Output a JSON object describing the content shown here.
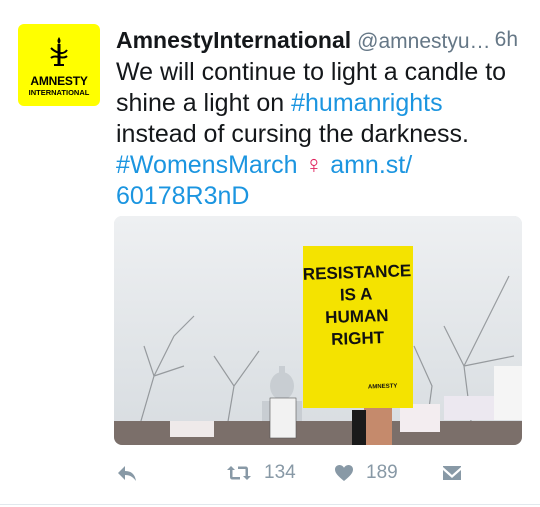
{
  "avatar": {
    "brand_line1": "AMNESTY",
    "brand_line2": "INTERNATIONAL",
    "icon": "candle-logo-icon",
    "color": "#ffff00"
  },
  "tweet": {
    "display_name": "AmnestyInternational",
    "handle": "@amnestyu…",
    "time": "6h",
    "text_part1": "We will continue to light a candle to shine a light on ",
    "hashtag1": "#humanrights",
    "text_part2": " instead of cursing the darkness. ",
    "hashtag2": "#WomensMarch",
    "emoji": "♀",
    "url": "amn.st/ 60178R3nD",
    "link_color": "#1b95e0"
  },
  "media": {
    "sign_line1": "RESISTANCE",
    "sign_line2": "IS A",
    "sign_line3": "HUMAN",
    "sign_line4": "RIGHT",
    "sign_brand": "AMNESTY"
  },
  "actions": {
    "reply_icon": "reply-icon",
    "retweet_icon": "retweet-icon",
    "retweet_count": "134",
    "like_icon": "heart-icon",
    "like_count": "189",
    "dm_icon": "envelope-icon",
    "icon_color": "#8899a6"
  }
}
